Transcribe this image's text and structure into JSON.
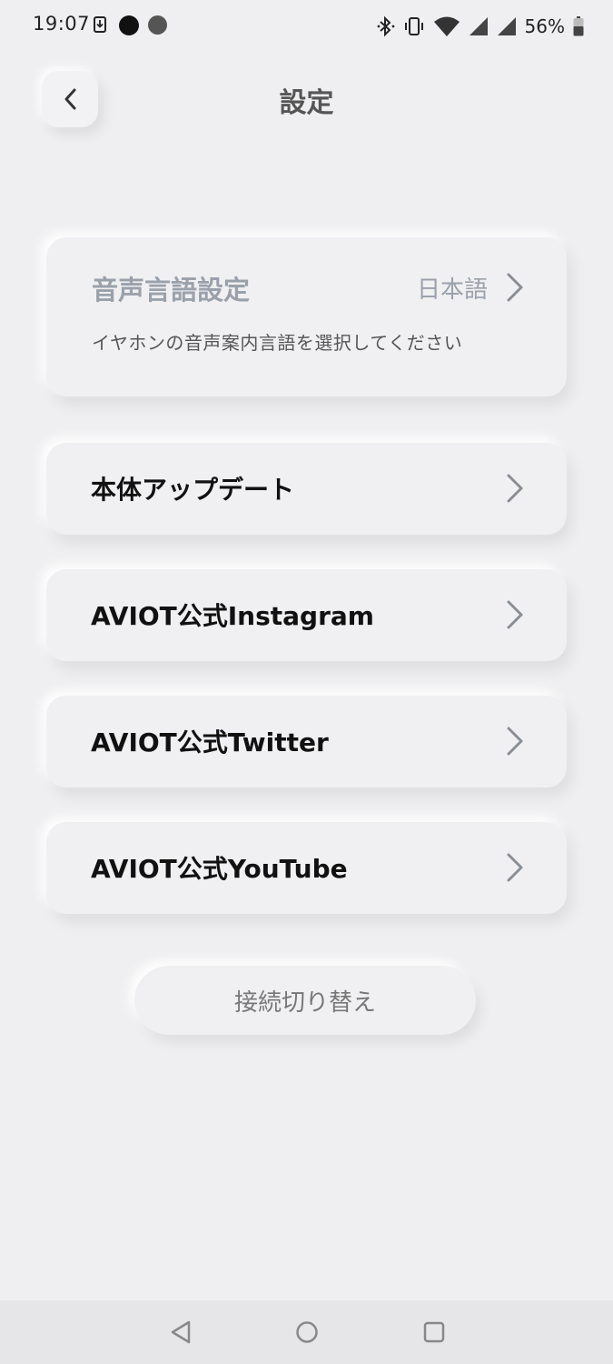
{
  "status_bar": {
    "time": "19:07",
    "battery": "56%",
    "icons": [
      "download-icon",
      "notification-dot-icon",
      "notification-dot-icon",
      "bluetooth-icon",
      "vibrate-icon",
      "wifi-icon",
      "signal-icon",
      "signal-icon",
      "battery-icon"
    ]
  },
  "header": {
    "title": "設定",
    "back_icon": "chevron-left-icon"
  },
  "language_card": {
    "title": "音声言語設定",
    "value": "日本語",
    "description": "イヤホンの音声案内言語を選択してください"
  },
  "menu": {
    "items": [
      {
        "label": "本体アップデート"
      },
      {
        "label": "AVIOT公式Instagram"
      },
      {
        "label": "AVIOT公式Twitter"
      },
      {
        "label": "AVIOT公式YouTube"
      }
    ]
  },
  "switch_button": {
    "label": "接続切り替え"
  },
  "nav_bar": {
    "icons": [
      "back-triangle-icon",
      "home-circle-icon",
      "recents-square-icon"
    ]
  },
  "colors": {
    "background": "#efeff1",
    "muted_text": "#9aa1ab",
    "chevron": "#8a8e94"
  }
}
